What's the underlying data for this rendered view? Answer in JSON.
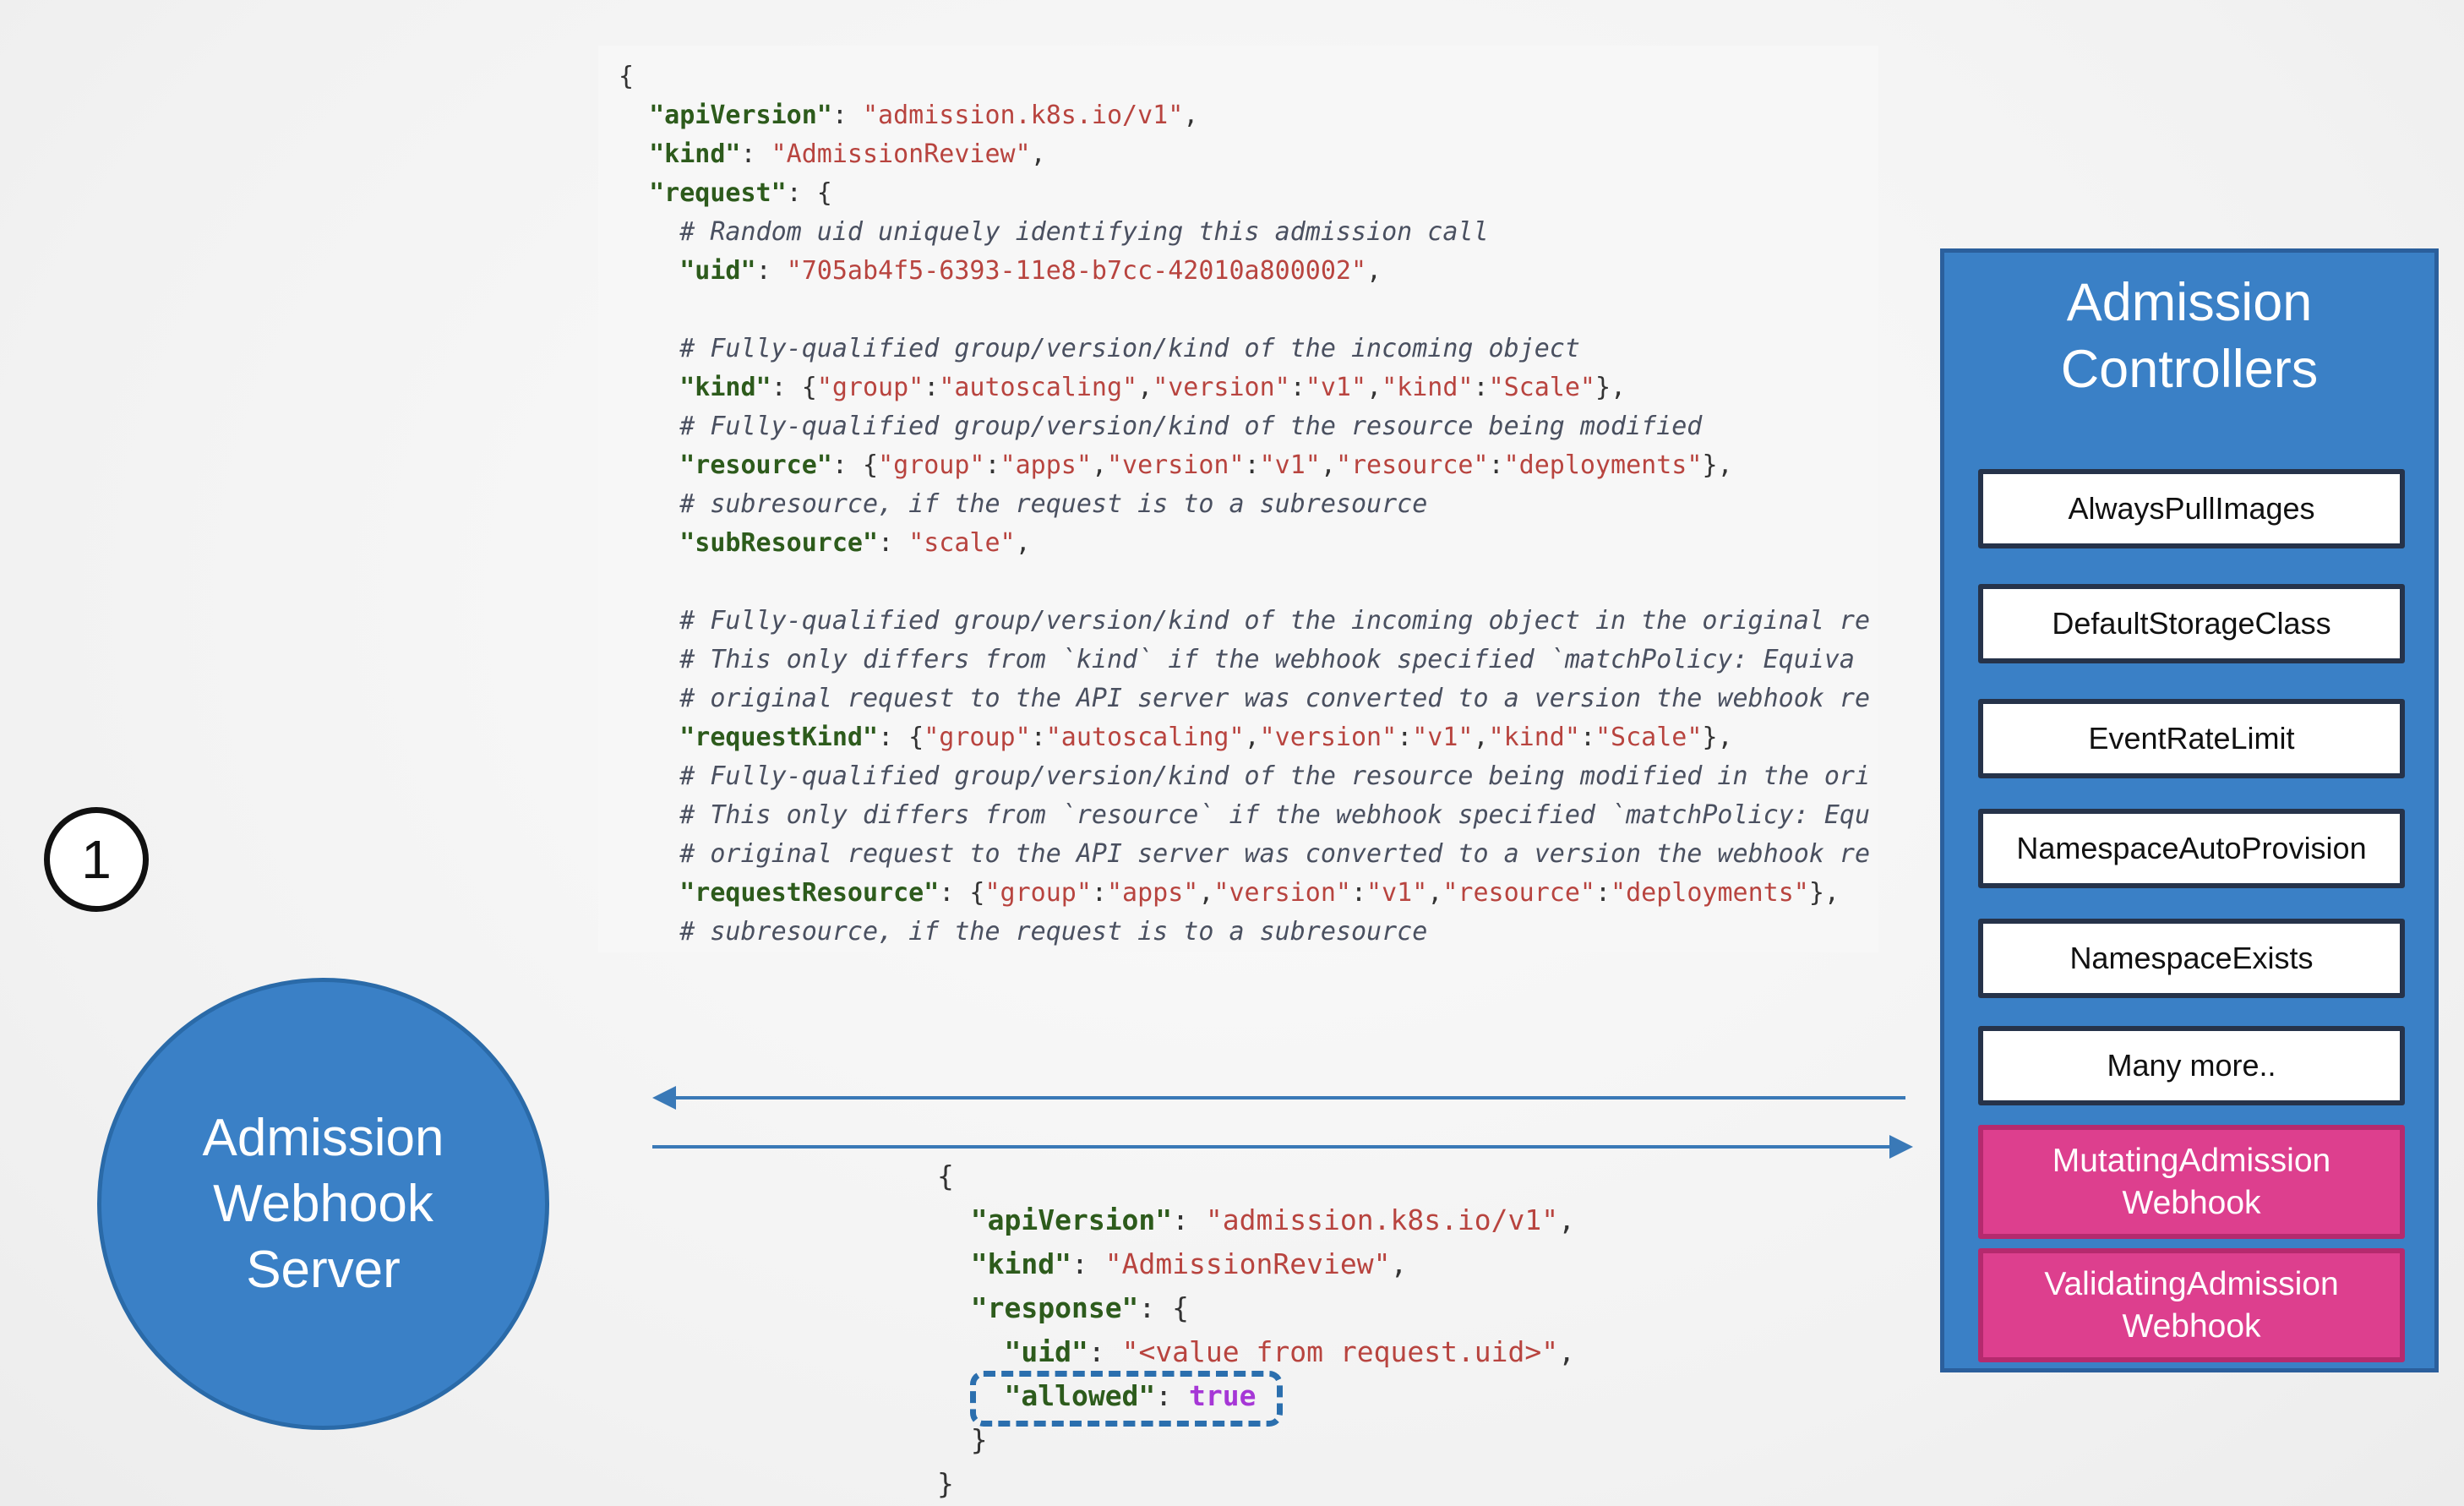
{
  "request_code": {
    "lines": [
      [
        [
          "p",
          "{"
        ]
      ],
      [
        [
          "p",
          "  "
        ],
        [
          "k",
          "\"apiVersion\""
        ],
        [
          "p",
          ": "
        ],
        [
          "s",
          "\"admission.k8s.io/v1\""
        ],
        [
          "p",
          ","
        ]
      ],
      [
        [
          "p",
          "  "
        ],
        [
          "k",
          "\"kind\""
        ],
        [
          "p",
          ": "
        ],
        [
          "s",
          "\"AdmissionReview\""
        ],
        [
          "p",
          ","
        ]
      ],
      [
        [
          "p",
          "  "
        ],
        [
          "k",
          "\"request\""
        ],
        [
          "p",
          ": {"
        ]
      ],
      [
        [
          "c",
          "    # Random uid uniquely identifying this admission call"
        ]
      ],
      [
        [
          "p",
          "    "
        ],
        [
          "k",
          "\"uid\""
        ],
        [
          "p",
          ": "
        ],
        [
          "s",
          "\"705ab4f5-6393-11e8-b7cc-42010a800002\""
        ],
        [
          "p",
          ","
        ]
      ],
      [
        [
          "p",
          ""
        ]
      ],
      [
        [
          "c",
          "    # Fully-qualified group/version/kind of the incoming object"
        ]
      ],
      [
        [
          "p",
          "    "
        ],
        [
          "k",
          "\"kind\""
        ],
        [
          "p",
          ": {"
        ],
        [
          "s",
          "\"group\""
        ],
        [
          "p",
          ":"
        ],
        [
          "s",
          "\"autoscaling\""
        ],
        [
          "p",
          ","
        ],
        [
          "s",
          "\"version\""
        ],
        [
          "p",
          ":"
        ],
        [
          "s",
          "\"v1\""
        ],
        [
          "p",
          ","
        ],
        [
          "s",
          "\"kind\""
        ],
        [
          "p",
          ":"
        ],
        [
          "s",
          "\"Scale\""
        ],
        [
          "p",
          "},"
        ]
      ],
      [
        [
          "c",
          "    # Fully-qualified group/version/kind of the resource being modified"
        ]
      ],
      [
        [
          "p",
          "    "
        ],
        [
          "k",
          "\"resource\""
        ],
        [
          "p",
          ": {"
        ],
        [
          "s",
          "\"group\""
        ],
        [
          "p",
          ":"
        ],
        [
          "s",
          "\"apps\""
        ],
        [
          "p",
          ","
        ],
        [
          "s",
          "\"version\""
        ],
        [
          "p",
          ":"
        ],
        [
          "s",
          "\"v1\""
        ],
        [
          "p",
          ","
        ],
        [
          "s",
          "\"resource\""
        ],
        [
          "p",
          ":"
        ],
        [
          "s",
          "\"deployments\""
        ],
        [
          "p",
          "},"
        ]
      ],
      [
        [
          "c",
          "    # subresource, if the request is to a subresource"
        ]
      ],
      [
        [
          "p",
          "    "
        ],
        [
          "k",
          "\"subResource\""
        ],
        [
          "p",
          ": "
        ],
        [
          "s",
          "\"scale\""
        ],
        [
          "p",
          ","
        ]
      ],
      [
        [
          "p",
          ""
        ]
      ],
      [
        [
          "c",
          "    # Fully-qualified group/version/kind of the incoming object in the original re"
        ]
      ],
      [
        [
          "c",
          "    # This only differs from `kind` if the webhook specified `matchPolicy: Equiva"
        ]
      ],
      [
        [
          "c",
          "    # original request to the API server was converted to a version the webhook re"
        ]
      ],
      [
        [
          "p",
          "    "
        ],
        [
          "k",
          "\"requestKind\""
        ],
        [
          "p",
          ": {"
        ],
        [
          "s",
          "\"group\""
        ],
        [
          "p",
          ":"
        ],
        [
          "s",
          "\"autoscaling\""
        ],
        [
          "p",
          ","
        ],
        [
          "s",
          "\"version\""
        ],
        [
          "p",
          ":"
        ],
        [
          "s",
          "\"v1\""
        ],
        [
          "p",
          ","
        ],
        [
          "s",
          "\"kind\""
        ],
        [
          "p",
          ":"
        ],
        [
          "s",
          "\"Scale\""
        ],
        [
          "p",
          "},"
        ]
      ],
      [
        [
          "c",
          "    # Fully-qualified group/version/kind of the resource being modified in the ori"
        ]
      ],
      [
        [
          "c",
          "    # This only differs from `resource` if the webhook specified `matchPolicy: Equ"
        ]
      ],
      [
        [
          "c",
          "    # original request to the API server was converted to a version the webhook re"
        ]
      ],
      [
        [
          "p",
          "    "
        ],
        [
          "k",
          "\"requestResource\""
        ],
        [
          "p",
          ": {"
        ],
        [
          "s",
          "\"group\""
        ],
        [
          "p",
          ":"
        ],
        [
          "s",
          "\"apps\""
        ],
        [
          "p",
          ","
        ],
        [
          "s",
          "\"version\""
        ],
        [
          "p",
          ":"
        ],
        [
          "s",
          "\"v1\""
        ],
        [
          "p",
          ","
        ],
        [
          "s",
          "\"resource\""
        ],
        [
          "p",
          ":"
        ],
        [
          "s",
          "\"deployments\""
        ],
        [
          "p",
          "},"
        ]
      ],
      [
        [
          "c",
          "    # subresource, if the request is to a subresource"
        ]
      ]
    ]
  },
  "response_code": {
    "lines": [
      [
        [
          "p",
          "{"
        ]
      ],
      [
        [
          "p",
          "  "
        ],
        [
          "k",
          "\"apiVersion\""
        ],
        [
          "p",
          ": "
        ],
        [
          "s",
          "\"admission.k8s.io/v1\""
        ],
        [
          "p",
          ","
        ]
      ],
      [
        [
          "p",
          "  "
        ],
        [
          "k",
          "\"kind\""
        ],
        [
          "p",
          ": "
        ],
        [
          "s",
          "\"AdmissionReview\""
        ],
        [
          "p",
          ","
        ]
      ],
      [
        [
          "p",
          "  "
        ],
        [
          "k",
          "\"response\""
        ],
        [
          "p",
          ": {"
        ]
      ],
      [
        [
          "p",
          "    "
        ],
        [
          "k",
          "\"uid\""
        ],
        [
          "p",
          ": "
        ],
        [
          "s",
          "\"<value from request.uid>\""
        ],
        [
          "p",
          ","
        ]
      ],
      [
        [
          "p",
          "    "
        ],
        [
          "k",
          "\"allowed\""
        ],
        [
          "p",
          ": "
        ],
        [
          "b",
          "true"
        ]
      ],
      [
        [
          "p",
          "  }"
        ]
      ],
      [
        [
          "p",
          "}"
        ]
      ]
    ]
  },
  "step_number": "1",
  "webhook_server": {
    "lines": [
      "Admission",
      "Webhook",
      "Server"
    ]
  },
  "admission_controllers": {
    "title_lines": [
      "Admission",
      "Controllers"
    ],
    "items": [
      {
        "label": [
          "AlwaysPullImages"
        ],
        "style": "plain"
      },
      {
        "label": [
          "DefaultStorageClass"
        ],
        "style": "plain"
      },
      {
        "label": [
          "EventRateLimit"
        ],
        "style": "plain"
      },
      {
        "label": [
          "NamespaceAutoProvision"
        ],
        "style": "plain"
      },
      {
        "label": [
          "NamespaceExists"
        ],
        "style": "plain"
      },
      {
        "label": [
          "Many more.."
        ],
        "style": "plain"
      },
      {
        "label": [
          "MutatingAdmission",
          "Webhook"
        ],
        "style": "pink"
      },
      {
        "label": [
          "ValidatingAdmission",
          "Webhook"
        ],
        "style": "pink"
      }
    ]
  },
  "colors": {
    "panel_blue": "#3a80c6",
    "arrow_blue": "#3a79b7",
    "pink": "#dd3f8e",
    "code_key": "#2d5b1c",
    "code_string": "#b8443f",
    "code_boolean": "#a637d6",
    "code_comment": "#4a5060"
  }
}
